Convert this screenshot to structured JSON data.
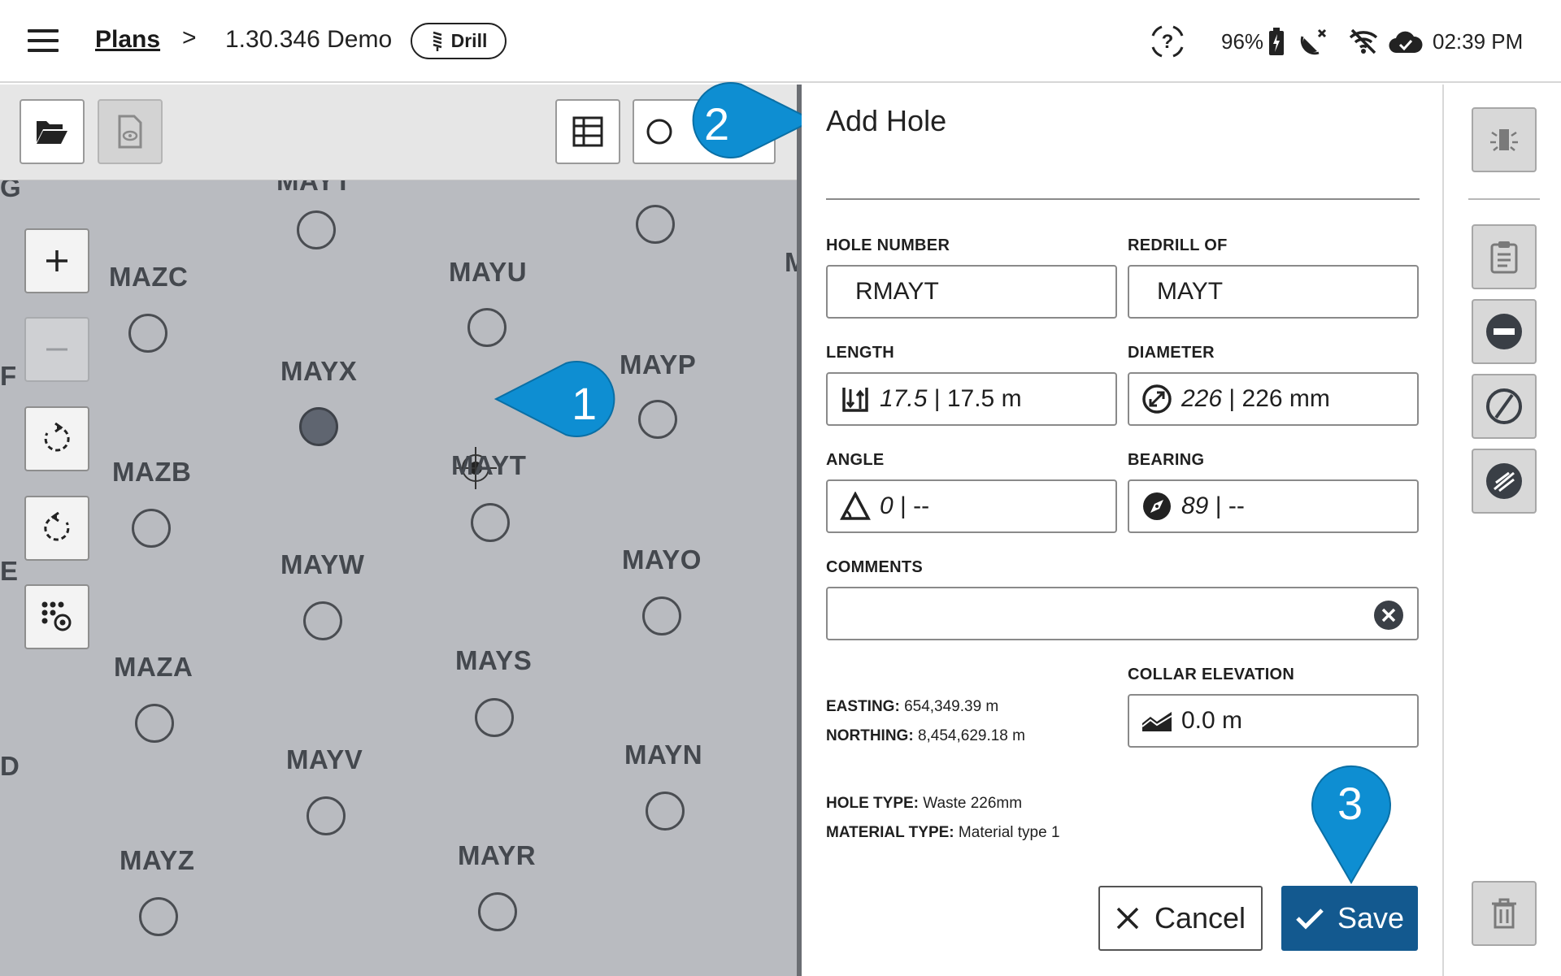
{
  "topbar": {
    "breadcrumb_link": "Plans",
    "breadcrumb_separator": ">",
    "breadcrumb_current": "1.30.346 Demo",
    "mode_chip": "Drill",
    "battery": "96%",
    "time": "02:39 PM"
  },
  "map": {
    "edge_labels": [
      "G",
      "F",
      "E",
      "D"
    ],
    "top_partial_label": "MAYT",
    "right_partial_label": "M",
    "holes": [
      {
        "label": "MAZC"
      },
      {
        "label": "MAYU"
      },
      {
        "label": "MAYX",
        "selected": true
      },
      {
        "label": "MAYP"
      },
      {
        "label": "MAZB"
      },
      {
        "label": "MAYT"
      },
      {
        "label": "MAYW"
      },
      {
        "label": "MAYO"
      },
      {
        "label": "MAZA"
      },
      {
        "label": "MAYS"
      },
      {
        "label": "MAYV"
      },
      {
        "label": "MAYN"
      },
      {
        "label": "MAYZ"
      },
      {
        "label": "MAYR"
      }
    ]
  },
  "callouts": {
    "one": "1",
    "two": "2",
    "three": "3"
  },
  "panel": {
    "title": "Add Hole",
    "hole_number": {
      "label": "HOLE NUMBER",
      "value": "RMAYT"
    },
    "redrill_of": {
      "label": "REDRILL OF",
      "value": "MAYT"
    },
    "length": {
      "label": "LENGTH",
      "value_design": "17.5",
      "value_actual": " | 17.5 m"
    },
    "diameter": {
      "label": "DIAMETER",
      "value_design": "226",
      "value_actual": " | 226 mm"
    },
    "angle": {
      "label": "ANGLE",
      "value_design": "0",
      "value_actual": " | --"
    },
    "bearing": {
      "label": "BEARING",
      "value_design": "89",
      "value_actual": " | --"
    },
    "comments": {
      "label": "COMMENTS",
      "value": ""
    },
    "collar_elevation": {
      "label": "COLLAR ELEVATION",
      "value": "0.0 m"
    },
    "easting": {
      "label": "EASTING:",
      "value": "654,349.39 m"
    },
    "northing": {
      "label": "NORTHING:",
      "value": "8,454,629.18 m"
    },
    "hole_type": {
      "label": "HOLE TYPE:",
      "value": "Waste 226mm"
    },
    "material_type": {
      "label": "MATERIAL TYPE:",
      "value": "Material type 1"
    },
    "cancel_label": "Cancel",
    "save_label": "Save"
  },
  "colors": {
    "accent": "#13598f",
    "callout": "#0e8ed2",
    "map_bg": "#b9bbc0"
  }
}
